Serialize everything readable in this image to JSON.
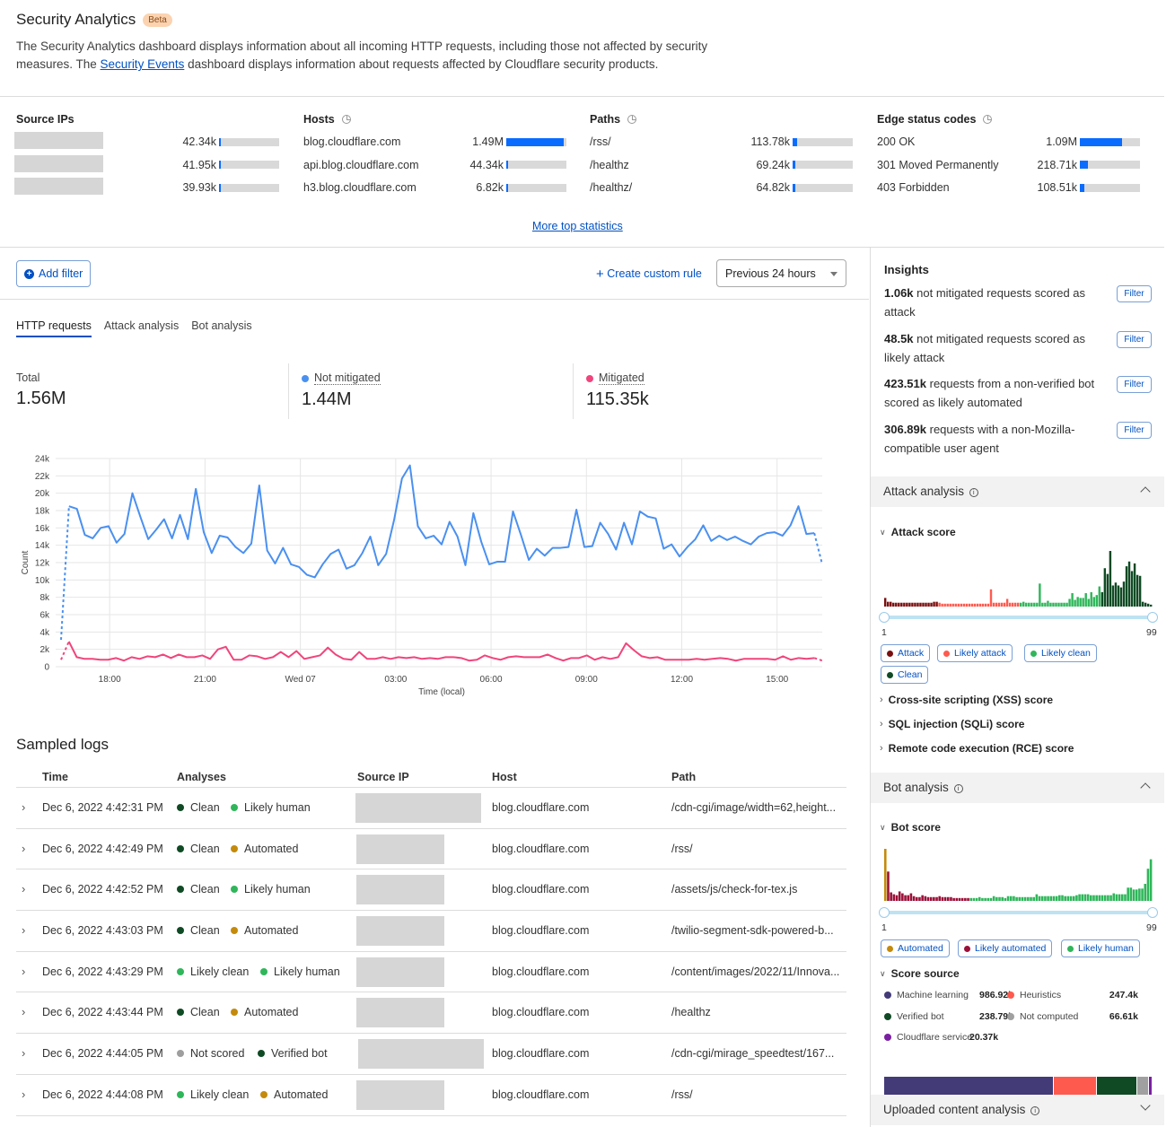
{
  "header": {
    "title": "Security Analytics",
    "badge": "Beta",
    "description_part1": "The Security Analytics dashboard displays information about all incoming HTTP requests, including those not affected by security measures. The ",
    "description_link": "Security Events",
    "description_part2": " dashboard displays information about requests affected by Cloudflare security products."
  },
  "top_stats": {
    "more_link": "More top statistics",
    "source_ips": {
      "title": "Source IPs",
      "rows": [
        {
          "label": "[redacted]",
          "value": "42.34k",
          "fraction": 0.028
        },
        {
          "label": "[redacted]",
          "value": "41.95k",
          "fraction": 0.028
        },
        {
          "label": "[redacted]",
          "value": "39.93k",
          "fraction": 0.027
        }
      ]
    },
    "hosts": {
      "title": "Hosts",
      "rows": [
        {
          "label": "blog.cloudflare.com",
          "value": "1.49M",
          "fraction": 0.96
        },
        {
          "label": "api.blog.cloudflare.com",
          "value": "44.34k",
          "fraction": 0.028
        },
        {
          "label": "h3.blog.cloudflare.com",
          "value": "6.82k",
          "fraction": 0.006
        }
      ]
    },
    "paths": {
      "title": "Paths",
      "rows": [
        {
          "label": "/rss/",
          "value": "113.78k",
          "fraction": 0.073
        },
        {
          "label": "/healthz",
          "value": "69.24k",
          "fraction": 0.044
        },
        {
          "label": "/healthz/",
          "value": "64.82k",
          "fraction": 0.042
        }
      ]
    },
    "edge_status_codes": {
      "title": "Edge status codes",
      "rows": [
        {
          "label": "200 OK",
          "value": "1.09M",
          "fraction": 0.7
        },
        {
          "label": "301 Moved Permanently",
          "value": "218.71k",
          "fraction": 0.14
        },
        {
          "label": "403 Forbidden",
          "value": "108.51k",
          "fraction": 0.07
        }
      ]
    }
  },
  "toolbar": {
    "add_filter": "Add filter",
    "create_rule": "Create custom rule",
    "time_range": "Previous 24 hours"
  },
  "tabs": [
    {
      "label": "HTTP requests",
      "active": true
    },
    {
      "label": "Attack analysis",
      "active": false
    },
    {
      "label": "Bot analysis",
      "active": false
    }
  ],
  "totals": {
    "total_label": "Total",
    "total_value": "1.56M",
    "not_mitigated_label": "Not mitigated",
    "not_mitigated_value": "1.44M",
    "mitigated_label": "Mitigated",
    "mitigated_value": "115.35k"
  },
  "colors": {
    "not_mitigated": "#4a90f0",
    "mitigated": "#f0457c",
    "accent": "#0051c3",
    "attack": "#7a0e0e",
    "likely_attack": "#ff5a4e",
    "likely_clean": "#2fb65a",
    "clean": "#0f4a24",
    "automated": "#c48a0c",
    "likely_automated": "#9b1038",
    "likely_human": "#2fb65a",
    "not_scored": "#9e9e9e",
    "verified_bot": "#0f4a24",
    "machine_learning": "#433a78",
    "heuristics": "#ff5a4e",
    "not_computed": "#a0a0a0",
    "cloudflare_service": "#7b1fa2"
  },
  "chart_data": {
    "type": "line",
    "title": "",
    "xlabel": "Time (local)",
    "ylabel": "Count",
    "ylim": [
      0,
      24000
    ],
    "yticks": [
      "0",
      "2k",
      "4k",
      "6k",
      "8k",
      "10k",
      "12k",
      "14k",
      "16k",
      "18k",
      "20k",
      "22k",
      "24k"
    ],
    "xticks": [
      "18:00",
      "21:00",
      "Wed 07",
      "03:00",
      "06:00",
      "09:00",
      "12:00",
      "15:00"
    ],
    "x_range_hours": [
      16.47,
      40.42
    ],
    "x_step_minutes": 15,
    "grid": true,
    "series": [
      {
        "name": "Not mitigated",
        "values": [
          3100,
          18500,
          18200,
          15200,
          14800,
          16000,
          16200,
          14300,
          15300,
          20000,
          17300,
          14700,
          15800,
          17000,
          14800,
          17500,
          14700,
          20500,
          15500,
          13100,
          15100,
          14900,
          13800,
          13100,
          14200,
          20900,
          13400,
          11900,
          13700,
          11800,
          11500,
          10600,
          10300,
          11800,
          13000,
          13500,
          11300,
          11700,
          13100,
          15000,
          11700,
          13000,
          16900,
          21700,
          23200,
          16200,
          14800,
          15100,
          14100,
          16700,
          15000,
          11700,
          17700,
          14400,
          11800,
          12100,
          12100,
          17900,
          15200,
          12300,
          13600,
          12800,
          13700,
          13700,
          13800,
          18100,
          13800,
          13900,
          16600,
          15300,
          13500,
          16600,
          14100,
          17900,
          17300,
          17100,
          13600,
          14100,
          12700,
          13800,
          14700,
          16300,
          14500,
          15100,
          14600,
          15000,
          14500,
          14100,
          15000,
          15400,
          15500,
          15100,
          16300,
          18500,
          15300,
          15400,
          11800
        ],
        "dashed_start_points": 2,
        "dashed_end_points": 2
      },
      {
        "name": "Mitigated",
        "values": [
          800,
          2900,
          1100,
          900,
          900,
          800,
          800,
          1000,
          700,
          1100,
          900,
          1200,
          1100,
          1400,
          1000,
          1400,
          1100,
          1100,
          1300,
          900,
          2000,
          2300,
          800,
          800,
          1300,
          1200,
          900,
          1100,
          1700,
          1100,
          1800,
          900,
          1100,
          1300,
          2200,
          1400,
          900,
          800,
          1700,
          900,
          900,
          1100,
          900,
          1100,
          1000,
          1100,
          900,
          1000,
          900,
          1100,
          1100,
          1000,
          700,
          800,
          1300,
          1000,
          800,
          1100,
          1200,
          1100,
          1100,
          1100,
          1400,
          1000,
          700,
          1000,
          1000,
          1300,
          800,
          1100,
          900,
          1100,
          2700,
          1900,
          1200,
          1000,
          1100,
          800,
          800,
          800,
          800,
          900,
          800,
          900,
          1000,
          900,
          700,
          900,
          900,
          900,
          900,
          800,
          1200,
          800,
          1000,
          900,
          1000,
          700
        ],
        "dashed_start_points": 2,
        "dashed_end_points": 2
      }
    ]
  },
  "logs": {
    "title": "Sampled logs",
    "columns": [
      "Time",
      "Analyses",
      "Source IP",
      "Host",
      "Path"
    ],
    "rows": [
      {
        "time": "Dec 6, 2022 4:42:31 PM",
        "a1": "Clean",
        "a1_color": "#0f4a24",
        "a2": "Likely human",
        "a2_color": "#2fb65a",
        "host": "blog.cloudflare.com",
        "path": "/cdn-cgi/image/width=62,height..."
      },
      {
        "time": "Dec 6, 2022 4:42:49 PM",
        "a1": "Clean",
        "a1_color": "#0f4a24",
        "a2": "Automated",
        "a2_color": "#c48a0c",
        "host": "blog.cloudflare.com",
        "path": "/rss/"
      },
      {
        "time": "Dec 6, 2022 4:42:52 PM",
        "a1": "Clean",
        "a1_color": "#0f4a24",
        "a2": "Likely human",
        "a2_color": "#2fb65a",
        "host": "blog.cloudflare.com",
        "path": "/assets/js/check-for-tex.js"
      },
      {
        "time": "Dec 6, 2022 4:43:03 PM",
        "a1": "Clean",
        "a1_color": "#0f4a24",
        "a2": "Automated",
        "a2_color": "#c48a0c",
        "host": "blog.cloudflare.com",
        "path": "/twilio-segment-sdk-powered-b..."
      },
      {
        "time": "Dec 6, 2022 4:43:29 PM",
        "a1": "Likely clean",
        "a1_color": "#2fb65a",
        "a2": "Likely human",
        "a2_color": "#2fb65a",
        "host": "blog.cloudflare.com",
        "path": "/content/images/2022/11/Innova..."
      },
      {
        "time": "Dec 6, 2022 4:43:44 PM",
        "a1": "Clean",
        "a1_color": "#0f4a24",
        "a2": "Automated",
        "a2_color": "#c48a0c",
        "host": "blog.cloudflare.com",
        "path": "/healthz"
      },
      {
        "time": "Dec 6, 2022 4:44:05 PM",
        "a1": "Not scored",
        "a1_color": "#9e9e9e",
        "a2": "Verified bot",
        "a2_color": "#0f4a24",
        "host": "blog.cloudflare.com",
        "path": "/cdn-cgi/mirage_speedtest/167..."
      },
      {
        "time": "Dec 6, 2022 4:44:08 PM",
        "a1": "Likely clean",
        "a1_color": "#2fb65a",
        "a2": "Automated",
        "a2_color": "#c48a0c",
        "host": "blog.cloudflare.com",
        "path": "/rss/"
      }
    ]
  },
  "insights": {
    "title": "Insights",
    "filter_label": "Filter",
    "items": [
      {
        "value": "1.06k",
        "text": " not mitigated requests scored as attack"
      },
      {
        "value": "48.5k",
        "text": " not mitigated requests scored as likely attack"
      },
      {
        "value": "423.51k",
        "text": " requests from a non-verified bot scored as likely automated"
      },
      {
        "value": "306.89k",
        "text": " requests with a non-Mozilla-compatible user agent"
      }
    ]
  },
  "attack_analysis": {
    "title": "Attack analysis",
    "score_title": "Attack score",
    "range_min": "1",
    "range_max": "99",
    "chips": [
      {
        "label": "Attack",
        "color": "#7a0e0e"
      },
      {
        "label": "Likely attack",
        "color": "#ff5a4e"
      },
      {
        "label": "Likely clean",
        "color": "#2fb65a"
      },
      {
        "label": "Clean",
        "color": "#0f4a24"
      }
    ],
    "collapsed": [
      "Cross-site scripting (XSS) score",
      "SQL injection (SQLi) score",
      "Remote code execution (RCE) score"
    ],
    "histogram": {
      "bands": [
        {
          "from": 1,
          "to": 20,
          "color": "#7a0e0e"
        },
        {
          "from": 21,
          "to": 50,
          "color": "#ff5a4e"
        },
        {
          "from": 51,
          "to": 80,
          "color": "#2fb65a"
        },
        {
          "from": 81,
          "to": 99,
          "color": "#0f4a24"
        }
      ],
      "values": [
        9,
        5,
        5,
        4,
        4,
        4,
        4,
        4,
        4,
        4,
        4,
        4,
        4,
        4,
        4,
        4,
        4,
        4,
        5,
        5,
        4,
        3,
        3,
        3,
        3,
        3,
        3,
        3,
        3,
        3,
        3,
        3,
        3,
        3,
        3,
        3,
        3,
        3,
        3,
        18,
        4,
        4,
        4,
        4,
        4,
        8,
        4,
        4,
        4,
        4,
        4,
        5,
        4,
        4,
        4,
        4,
        4,
        24,
        4,
        4,
        6,
        4,
        4,
        4,
        4,
        4,
        4,
        4,
        4,
        4,
        4,
        4,
        4,
        4,
        4,
        5,
        12,
        5,
        5,
        5,
        13,
        6,
        5,
        5,
        5,
        6,
        5,
        5,
        5,
        5,
        5,
        6,
        6,
        6,
        6,
        6,
        6,
        6,
        8
      ]
    }
  },
  "attack_hist_tail": [
    8,
    14,
    7,
    10,
    9,
    9,
    14,
    8,
    15,
    10,
    12,
    21,
    15,
    40,
    34,
    58,
    22,
    25,
    22,
    20,
    26,
    42,
    47,
    37,
    45,
    33,
    32,
    5,
    4,
    3,
    2
  ],
  "bot_analysis": {
    "title": "Bot analysis",
    "score_title": "Bot score",
    "range_min": "1",
    "range_max": "99",
    "chips": [
      {
        "label": "Automated",
        "color": "#c48a0c"
      },
      {
        "label": "Likely automated",
        "color": "#9b1038"
      },
      {
        "label": "Likely human",
        "color": "#2fb65a"
      }
    ],
    "histogram": {
      "values": [
        55,
        31,
        9,
        7,
        6,
        10,
        8,
        6,
        6,
        8,
        5,
        4,
        4,
        6,
        5,
        4,
        4,
        4,
        4,
        5,
        4,
        4,
        4,
        4,
        3,
        3,
        3,
        3,
        3,
        3,
        3,
        3,
        3,
        4,
        3,
        3,
        3,
        3,
        5,
        4,
        4,
        4,
        3,
        5,
        5,
        5,
        4,
        4,
        4,
        4,
        4,
        4,
        4,
        7,
        5,
        5,
        5,
        5,
        5,
        5,
        5,
        6,
        6,
        5,
        5,
        5,
        5,
        6,
        7,
        7,
        7,
        7,
        6,
        6,
        6,
        6,
        6,
        6,
        6,
        6,
        8,
        7,
        7,
        7,
        7,
        14,
        14,
        12,
        12,
        13,
        13,
        18,
        34,
        44
      ]
    },
    "score_source_title": "Score source",
    "sources": [
      {
        "label": "Machine learning",
        "value": "986.92k",
        "raw": 986920,
        "color": "#433a78"
      },
      {
        "label": "Heuristics",
        "value": "247.4k",
        "raw": 247400,
        "color": "#ff5a4e"
      },
      {
        "label": "Verified bot",
        "value": "238.79k",
        "raw": 238790,
        "color": "#0f4a24"
      },
      {
        "label": "Not computed",
        "value": "66.61k",
        "raw": 66610,
        "color": "#a0a0a0"
      },
      {
        "label": "Cloudflare service",
        "value": "20.37k",
        "raw": 20370,
        "color": "#7b1fa2"
      }
    ]
  },
  "uploaded_content": {
    "title": "Uploaded content analysis"
  }
}
